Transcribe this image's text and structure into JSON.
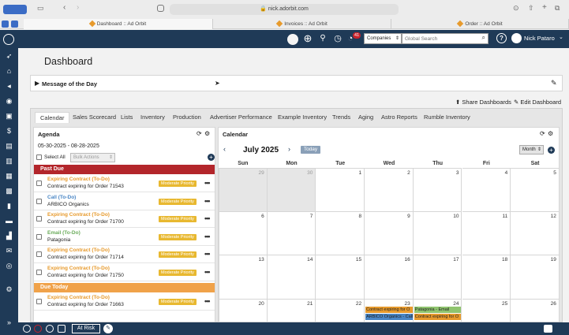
{
  "browser": {
    "url": "nick.adorbit.com",
    "tabs": [
      {
        "label": "Dashboard :: Ad Orbit"
      },
      {
        "label": "Invoices :: Ad Orbit"
      },
      {
        "label": "Order :: Ad Orbit"
      }
    ]
  },
  "header": {
    "notification_count": "41",
    "search_scope": "Companies",
    "search_placeholder": "Global Search",
    "user_name": "Nick Pataro"
  },
  "page": {
    "title": "Dashboard",
    "motd_label": "Message of the Day",
    "share_label": "Share Dashboards",
    "edit_label": "Edit Dashboard"
  },
  "tabs": [
    "Calendar",
    "Sales Scorecard",
    "Lists",
    "Inventory",
    "Production",
    "Advertiser Performance",
    "Example Inventory",
    "Trends",
    "Aging",
    "Astro Reports",
    "Rumble Inventory"
  ],
  "agenda": {
    "title": "Agenda",
    "date_range": "05-30-2025 - 08-28-2025",
    "select_all": "Select All",
    "bulk_actions": "Bulk Actions",
    "past_due_label": "Past Due",
    "due_today_label": "Due Today",
    "past_due": [
      {
        "type": "Expiring Contract (To-Do)",
        "detail": "Contract expiring for Order 71543",
        "priority": "Moderate Priority",
        "color": "#e79a2c"
      },
      {
        "type": "Call (To-Do)",
        "detail": "ARBICO Organics",
        "priority": "Moderate Priority",
        "color": "#4a86c5"
      },
      {
        "type": "Expiring Contract (To-Do)",
        "detail": "Contract expiring for Order 71700",
        "priority": "Moderate Priority",
        "color": "#e79a2c"
      },
      {
        "type": "Email (To-Do)",
        "detail": "Patagonia",
        "priority": "Moderate Priority",
        "color": "#6aab5a"
      },
      {
        "type": "Expiring Contract (To-Do)",
        "detail": "Contract expiring for Order 71714",
        "priority": "Moderate Priority",
        "color": "#e79a2c"
      },
      {
        "type": "Expiring Contract (To-Do)",
        "detail": "Contract expiring for Order 71750",
        "priority": "Moderate Priority",
        "color": "#e79a2c"
      }
    ],
    "due_today": [
      {
        "type": "Expiring Contract (To-Do)",
        "detail": "Contract expiring for Order 71663",
        "priority": "Moderate Priority",
        "color": "#e79a2c"
      }
    ]
  },
  "calendar": {
    "title": "Calendar",
    "month_label": "July 2025",
    "today_label": "Today",
    "view_select": "Month",
    "weekdays": [
      "Sun",
      "Mon",
      "Tue",
      "Wed",
      "Thu",
      "Fri",
      "Sat"
    ],
    "weeks": [
      [
        "29",
        "30",
        "1",
        "2",
        "3",
        "4",
        "5"
      ],
      [
        "6",
        "7",
        "8",
        "9",
        "10",
        "11",
        "12"
      ],
      [
        "13",
        "14",
        "15",
        "16",
        "17",
        "18",
        "19"
      ],
      [
        "20",
        "21",
        "22",
        "23",
        "24",
        "25",
        "26"
      ]
    ],
    "events": [
      {
        "label": "Contract expiring for O",
        "color": "#e79a2c"
      },
      {
        "label": "ARBICO Organics - Call",
        "color": "#4a86c5"
      },
      {
        "label": "Patagonia - Email",
        "color": "#8fc46e"
      },
      {
        "label": "Contract expiring for O",
        "color": "#e79a2c"
      }
    ]
  },
  "footer": {
    "at_risk_label": "At Risk"
  },
  "colors": {
    "navy": "#1f3a57",
    "past_due": "#b3262b",
    "due_today": "#f0a24a",
    "priority": "#e8b830"
  }
}
